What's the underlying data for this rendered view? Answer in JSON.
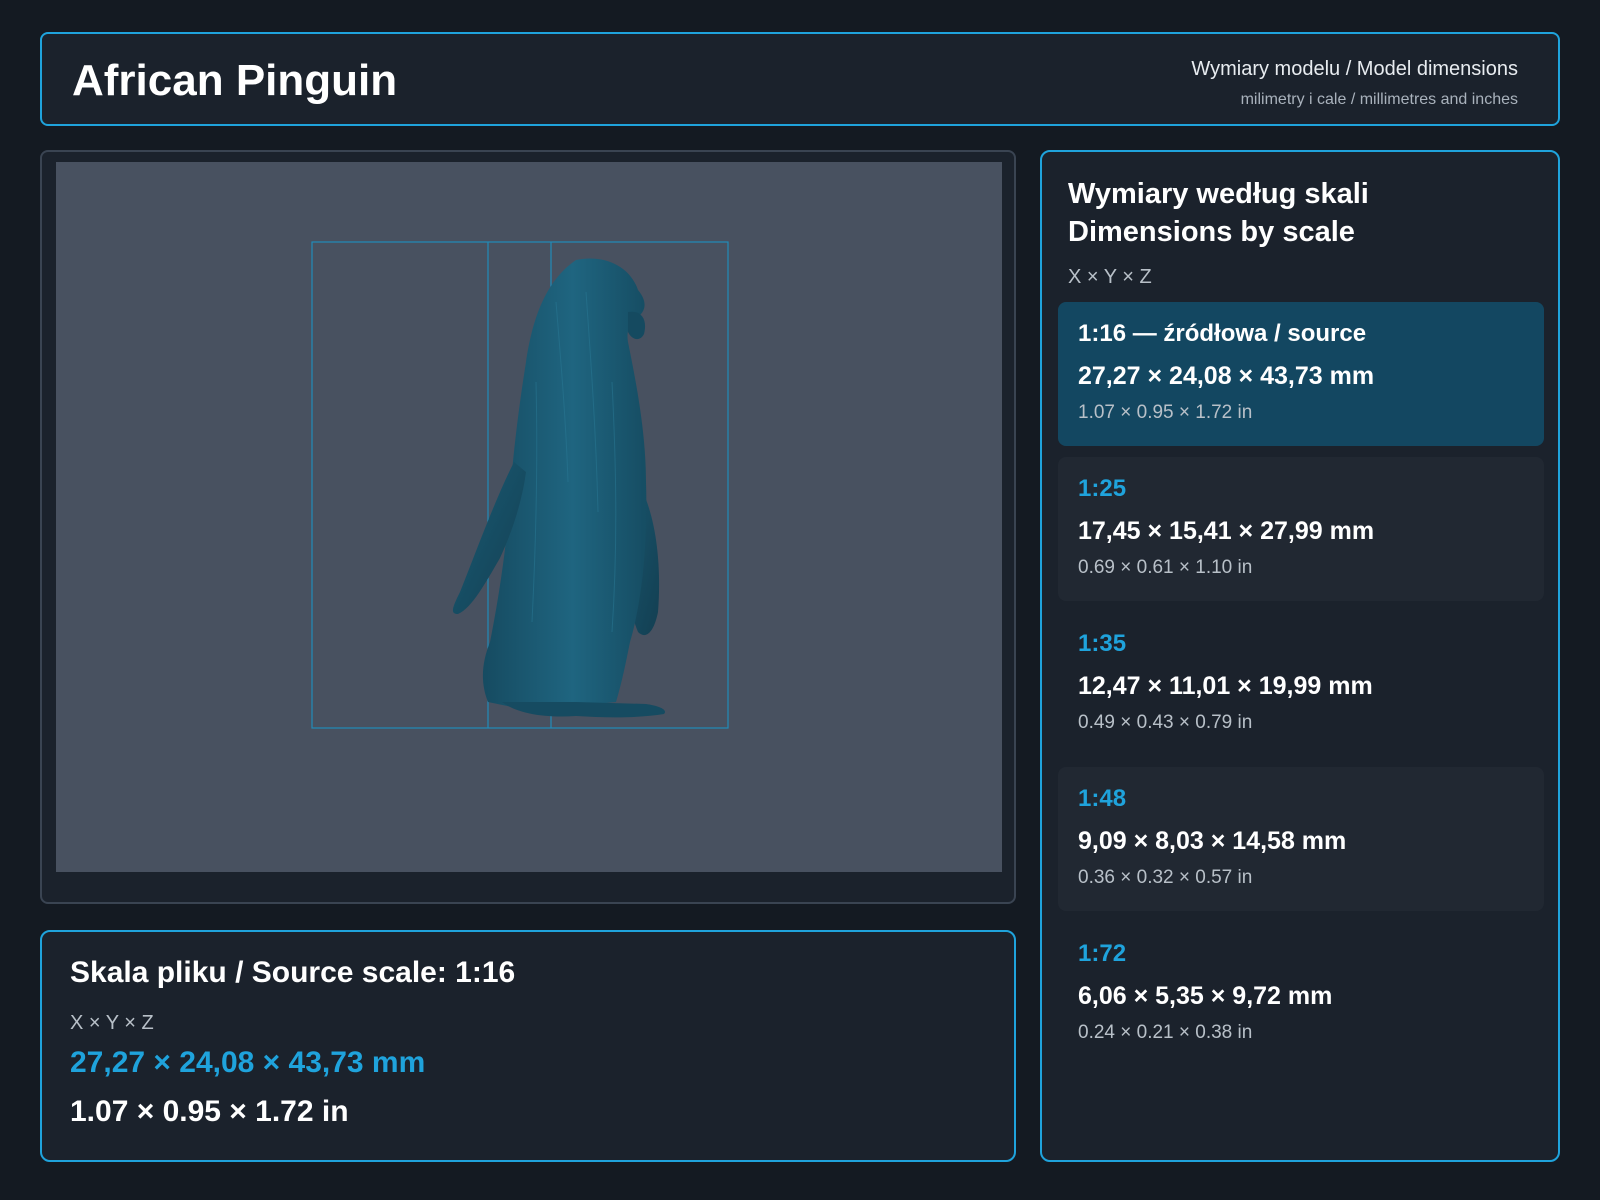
{
  "header": {
    "title": "African Pinguin",
    "subtitle": "Wymiary modelu / Model dimensions",
    "units_note": "milimetry i cale / millimetres and inches"
  },
  "source": {
    "title": "Skala pliku / Source scale: 1:16",
    "axes": "X × Y × Z",
    "mm": "27,27 × 24,08 × 43,73 mm",
    "inches": "1.07 × 0.95 × 1.72 in"
  },
  "scales": {
    "title_line1": "Wymiary według skali",
    "title_line2": "Dimensions by scale",
    "axes": "X × Y × Z",
    "items": [
      {
        "label": "1:16  —  źródłowa / source",
        "mm": "27,27 × 24,08 × 43,73 mm",
        "inches": "1.07 × 0.95 × 1.72 in"
      },
      {
        "label": "1:25",
        "mm": "17,45 × 15,41 × 27,99 mm",
        "inches": "0.69 × 0.61 × 1.10 in"
      },
      {
        "label": "1:35",
        "mm": "12,47 × 11,01 × 19,99 mm",
        "inches": "0.49 × 0.43 × 0.79 in"
      },
      {
        "label": "1:48",
        "mm": "9,09 × 8,03 × 14,58 mm",
        "inches": "0.36 × 0.32 × 0.57 in"
      },
      {
        "label": "1:72",
        "mm": "6,06 × 5,35 × 9,72 mm",
        "inches": "0.24 × 0.21 × 0.38 in"
      }
    ]
  },
  "colors": {
    "accent": "#1fa3dc",
    "background": "#141a22",
    "panel": "#1b222c",
    "active_card": "#134761",
    "model": "#1d5a72"
  },
  "icons": {
    "model": "penguin-model-render"
  }
}
